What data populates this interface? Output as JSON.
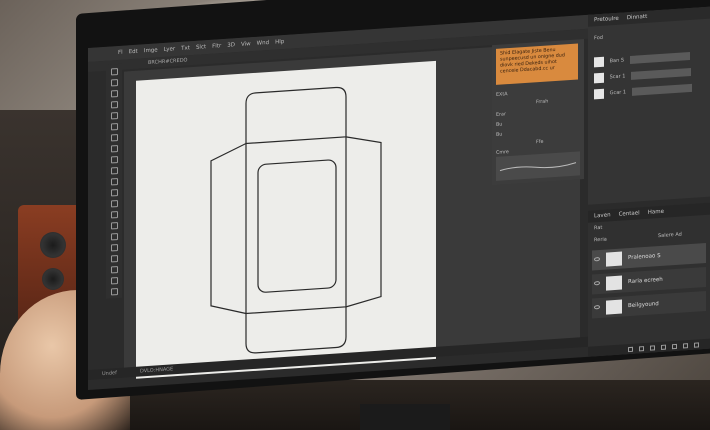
{
  "app": {
    "menu": [
      "Fl",
      "Edt",
      "Imge",
      "Lyer",
      "Txt",
      "Slct",
      "Fltr",
      "3D",
      "Viw",
      "Wnd",
      "Hlp"
    ],
    "options_bar": "BRCHR#CREDO"
  },
  "status": {
    "zoom": "Undef",
    "doc": "DVLO:HNAGE"
  },
  "panels": {
    "properties": {
      "tabs": [
        "Pretoulre",
        "Dinnatt"
      ],
      "rows": [
        "Fod",
        "Ban S",
        "Scar 1",
        "Gcar 1"
      ]
    },
    "adjust": {
      "notice": "Shid Elagate Jiste Benu sunpeecusd un onigne dud diovk ried Dekeds uihot cenceie Ddacabd.cc ur",
      "rows": [
        "EXtA",
        "Frrah",
        "Erar",
        "Bu",
        "Bu",
        "Ffe",
        "Cmre"
      ]
    },
    "layers": {
      "tabs": [
        "Laven",
        "Centael",
        "Hame"
      ],
      "filter": "Rat",
      "search": "Reria",
      "search_right": "Salere Ad",
      "items": [
        {
          "name": "Pralenoao S",
          "selected": true
        },
        {
          "name": "Raria ecreeh",
          "selected": false
        },
        {
          "name": "Beilgyound",
          "selected": false
        }
      ]
    }
  }
}
